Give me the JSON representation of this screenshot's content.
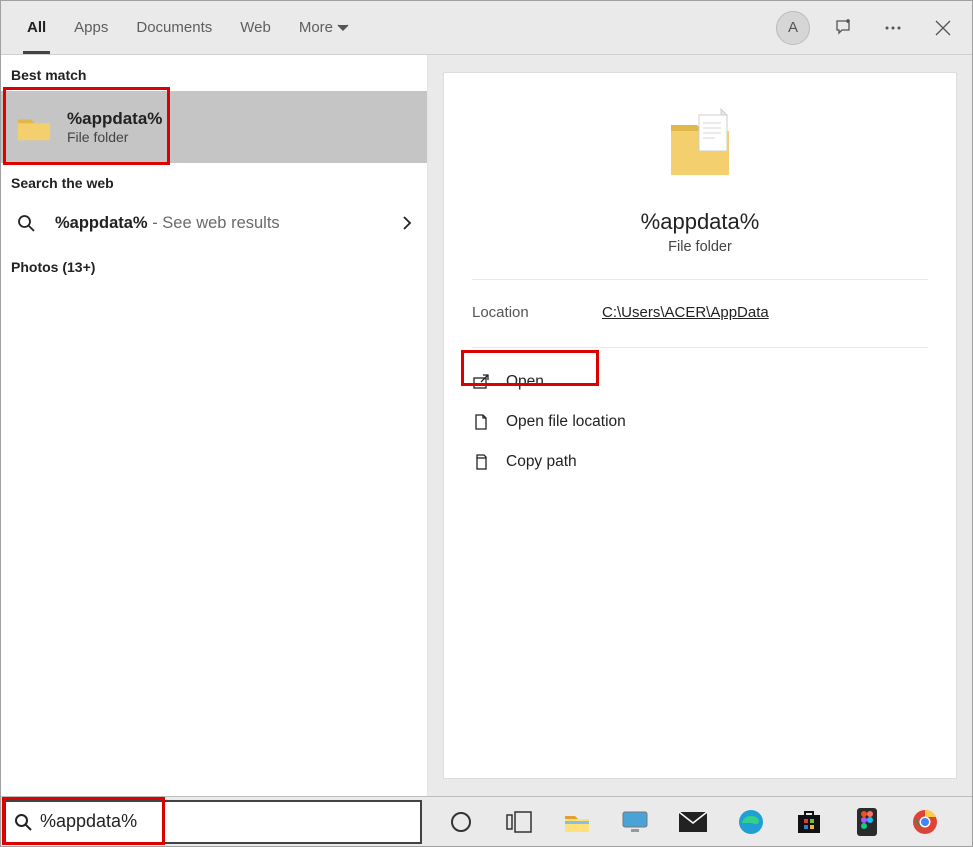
{
  "topbar": {
    "tabs": [
      "All",
      "Apps",
      "Documents",
      "Web",
      "More"
    ],
    "active": "All",
    "avatar": "A"
  },
  "left": {
    "best_match_label": "Best match",
    "result_title": "%appdata%",
    "result_sub": "File folder",
    "search_web_label": "Search the web",
    "web_query": "%appdata%",
    "web_hint": " - See web results",
    "photos_label": "Photos (13+)"
  },
  "preview": {
    "title": "%appdata%",
    "sub": "File folder",
    "location_label": "Location",
    "location_value": "C:\\Users\\ACER\\AppData",
    "actions": [
      "Open",
      "Open file location",
      "Copy path"
    ]
  },
  "taskbar": {
    "search_value": "%appdata%"
  }
}
